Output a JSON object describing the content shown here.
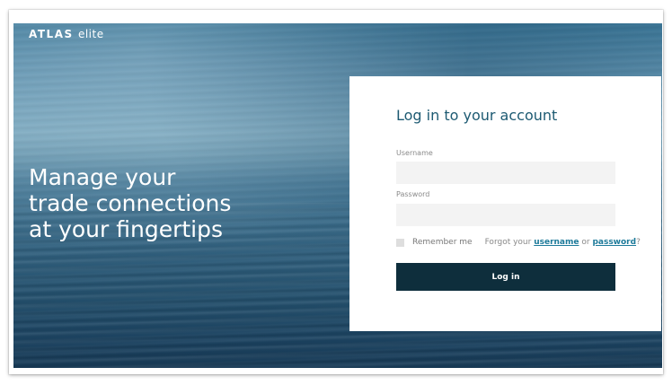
{
  "brand": {
    "name": "ATLAS",
    "tier": "elite"
  },
  "hero": {
    "tagline": [
      "Manage your",
      "trade connections",
      "at your fingertips"
    ]
  },
  "login": {
    "title": "Log in to your account",
    "username_label": "Username",
    "username_value": "",
    "password_label": "Password",
    "password_value": "",
    "remember_label": "Remember me",
    "remember_checked": false,
    "forgot_prefix": "Forgot your",
    "forgot_username_link": "username",
    "forgot_or": "or",
    "forgot_password_link": "password",
    "forgot_suffix": "?",
    "submit_label": "Log in"
  },
  "colors": {
    "title": "#1d5a72",
    "button_bg": "#0e2e3c",
    "link": "#1d7a9a",
    "input_bg": "#f3f3f3"
  }
}
